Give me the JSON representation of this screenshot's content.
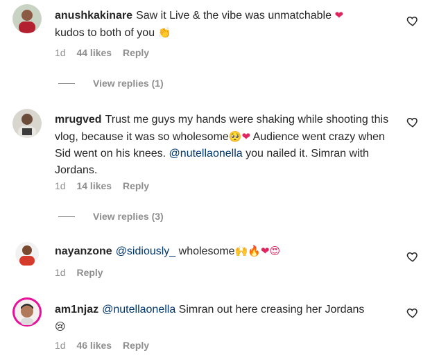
{
  "comments": [
    {
      "username": "anushkakinare",
      "text": "Saw it Live & the vibe was unmatchable ",
      "emoji_1": "❤",
      "text_2": "kudos to both of you ",
      "emoji_2": "👏",
      "time": "1d",
      "likes": "44 likes",
      "reply": "Reply",
      "view_replies": "View replies (1)"
    },
    {
      "username": "mrugved",
      "text": "Trust me guys my hands were shaking while shooting this vlog, because it was so wholesome",
      "emoji_1": "🥺❤",
      "text_2": " Audience went crazy when Sid went on his knees. ",
      "mention": "@nutellaonella",
      "text_3": " you nailed it. Simran with Jordans.",
      "time": "1d",
      "likes": "14 likes",
      "reply": "Reply",
      "view_replies": "View replies (3)"
    },
    {
      "username": "nayanzone",
      "mention": "@sidiously_",
      "text": " wholesome",
      "emoji_1": "🙌🔥❤😍",
      "time": "1d",
      "reply": "Reply"
    },
    {
      "username": "am1njaz",
      "mention": "@nutellaonella",
      "text": " Simran out here creasing her Jordans",
      "emoji_1": "😢",
      "time": "1d",
      "likes": "46 likes",
      "reply": "Reply"
    }
  ],
  "colors": {
    "text": "#262626",
    "secondary": "#8e8e8e",
    "mention": "#00376b",
    "heart_red": "#ed4956"
  }
}
